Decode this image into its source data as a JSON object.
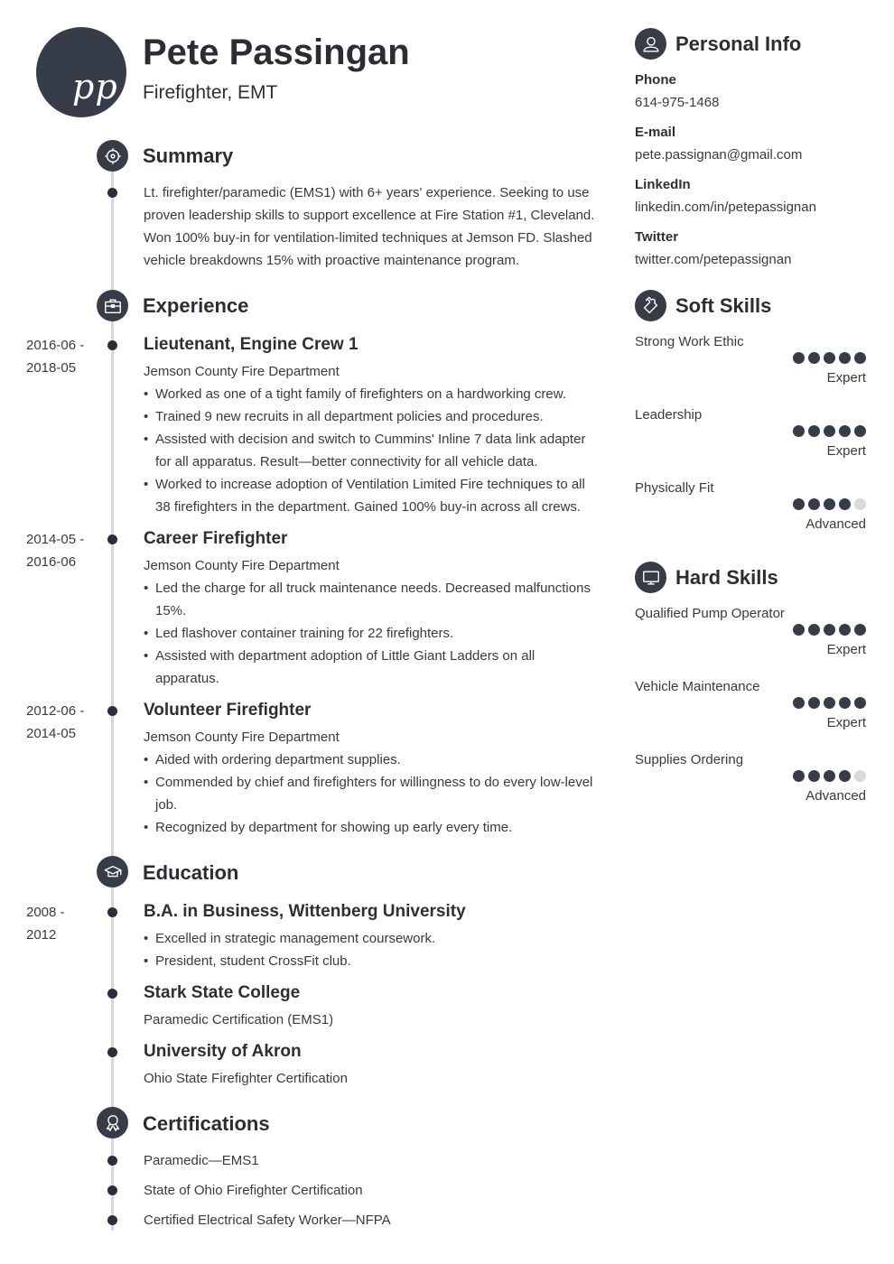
{
  "header": {
    "initials": "pp",
    "name": "Pete Passingan",
    "title": "Firefighter, EMT"
  },
  "sections": {
    "summary": {
      "title": "Summary",
      "icon": "target-icon",
      "text": "Lt. firefighter/paramedic (EMS1) with 6+ years' experience. Seeking to use proven leadership skills to support excellence at Fire Station #1, Cleveland. Won 100% buy-in for ventilation-limited techniques at Jemson FD. Slashed vehicle breakdowns 15% with proactive maintenance program."
    },
    "experience": {
      "title": "Experience",
      "icon": "briefcase-icon",
      "entries": [
        {
          "date_start": "2016-06 -",
          "date_end": "2018-05",
          "title": "Lieutenant, Engine Crew 1",
          "company": "Jemson County Fire Department",
          "bullets": [
            "Worked as one of a tight family of firefighters on a hardworking crew.",
            "Trained 9 new recruits in all department policies and procedures.",
            "Assisted with decision and switch to Cummins' Inline 7 data link adapter for all apparatus. Result—better connectivity for all vehicle data.",
            "Worked to increase adoption of Ventilation Limited Fire techniques to all 38 firefighters in the department. Gained 100% buy-in across all crews."
          ]
        },
        {
          "date_start": "2014-05 -",
          "date_end": "2016-06",
          "title": "Career Firefighter",
          "company": "Jemson County Fire Department",
          "bullets": [
            "Led the charge for all truck maintenance needs. Decreased malfunctions 15%.",
            "Led flashover container training for 22 firefighters.",
            "Assisted with department adoption of Little Giant Ladders on all apparatus."
          ]
        },
        {
          "date_start": "2012-06 -",
          "date_end": "2014-05",
          "title": "Volunteer Firefighter",
          "company": "Jemson County Fire Department",
          "bullets": [
            "Aided with ordering department supplies.",
            "Commended by chief and firefighters for willingness to do every low-level job.",
            "Recognized by department for showing up early every time."
          ]
        }
      ]
    },
    "education": {
      "title": "Education",
      "icon": "graduation-cap-icon",
      "entries": [
        {
          "date_start": "2008 -",
          "date_end": "2012",
          "title": "B.A. in Business, Wittenberg University",
          "bullets": [
            "Excelled in strategic management coursework.",
            "President, student CrossFit club."
          ]
        },
        {
          "title": "Stark State College",
          "subtitle": "Paramedic Certification (EMS1)"
        },
        {
          "title": "University of Akron",
          "subtitle": "Ohio State Firefighter Certification"
        }
      ]
    },
    "certifications": {
      "title": "Certifications",
      "icon": "award-ribbon-icon",
      "items": [
        "Paramedic—EMS1",
        "State of Ohio Firefighter Certification",
        "Certified Electrical Safety Worker—NFPA"
      ]
    }
  },
  "sidebar": {
    "personal_info": {
      "title": "Personal Info",
      "icon": "person-icon",
      "fields": [
        {
          "label": "Phone",
          "value": "614-975-1468"
        },
        {
          "label": "E-mail",
          "value": "pete.passignan@gmail.com"
        },
        {
          "label": "LinkedIn",
          "value": "linkedin.com/in/petepassignan"
        },
        {
          "label": "Twitter",
          "value": "twitter.com/petepassignan"
        }
      ]
    },
    "soft_skills": {
      "title": "Soft Skills",
      "icon": "puzzle-piece-icon",
      "items": [
        {
          "name": "Strong Work Ethic",
          "rating": 5,
          "max": 5,
          "level": "Expert"
        },
        {
          "name": "Leadership",
          "rating": 5,
          "max": 5,
          "level": "Expert"
        },
        {
          "name": "Physically Fit",
          "rating": 4,
          "max": 5,
          "level": "Advanced"
        }
      ]
    },
    "hard_skills": {
      "title": "Hard Skills",
      "icon": "monitor-icon",
      "items": [
        {
          "name": "Qualified Pump Operator",
          "rating": 5,
          "max": 5,
          "level": "Expert"
        },
        {
          "name": "Vehicle Maintenance",
          "rating": 5,
          "max": 5,
          "level": "Expert"
        },
        {
          "name": "Supplies Ordering",
          "rating": 4,
          "max": 5,
          "level": "Advanced"
        }
      ]
    }
  },
  "colors": {
    "accent": "#373d48",
    "text": "#2d2f33",
    "timeline": "#d6d6d6",
    "rating_off": "#d9d9d9"
  }
}
